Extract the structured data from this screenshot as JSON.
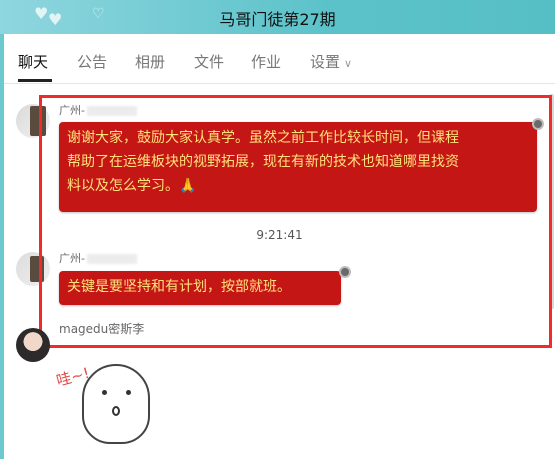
{
  "window": {
    "title": "马哥门徒第27期"
  },
  "tabs": [
    {
      "label": "聊天"
    },
    {
      "label": "公告"
    },
    {
      "label": "相册"
    },
    {
      "label": "文件"
    },
    {
      "label": "作业"
    },
    {
      "label": "设置"
    }
  ],
  "messages": [
    {
      "sender": "广州-",
      "lines": [
        "谢谢大家，鼓励大家认真学。虽然之前工作比较长时间，但课程",
        "帮助了在运维板块的视野拓展，现在有新的技术也知道哪里找资",
        "料以及怎么学习。"
      ]
    },
    {
      "sender": "广州-",
      "lines": [
        "关键是要坚持和有计划，按部就班。"
      ]
    }
  ],
  "timestamp": "9:21:41",
  "third_sender": "magedu密斯李",
  "sticker_text": "哇~!",
  "colors": {
    "bubble": "#c51616",
    "bubble_text": "#ffe27a",
    "highlight": "#ef2b2b",
    "titlebar": "#5bc2c9"
  }
}
